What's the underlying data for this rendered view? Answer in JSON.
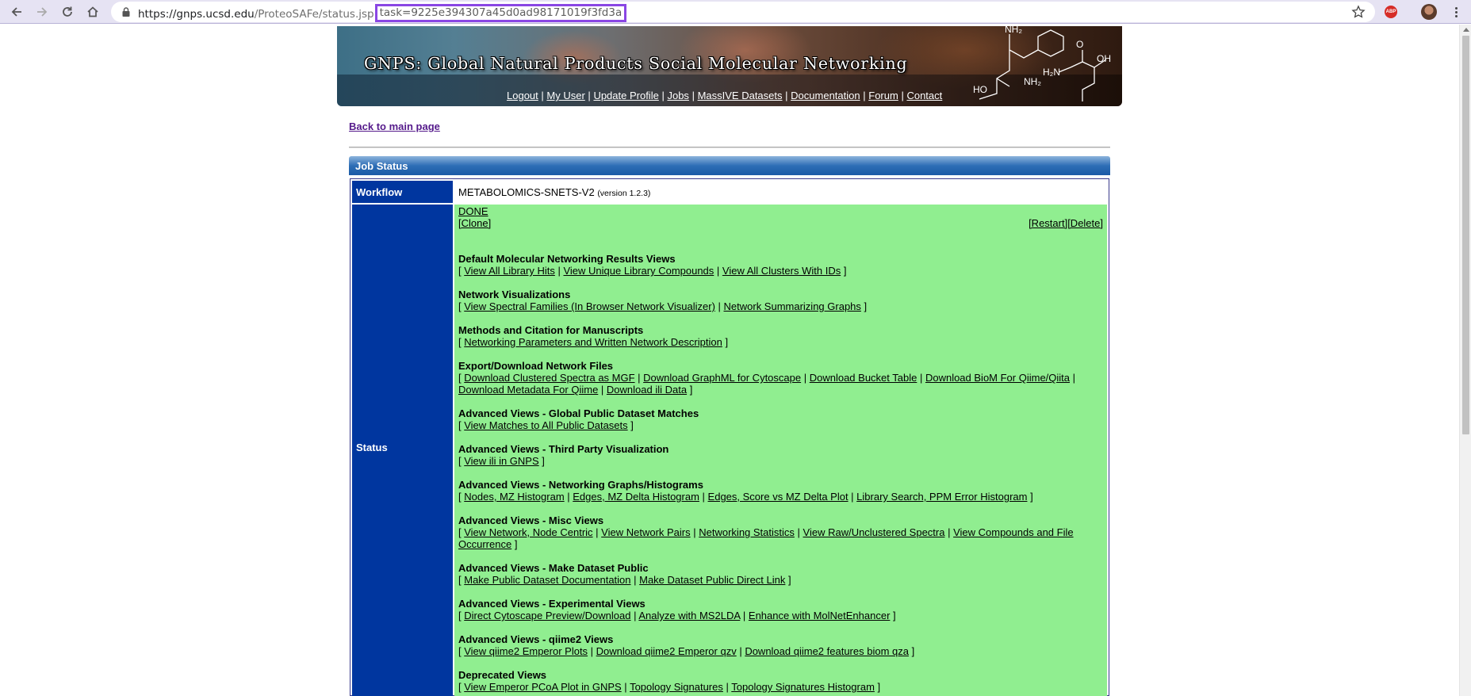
{
  "browser": {
    "url_host": "https://gnps.ucsd.edu",
    "url_path": "/ProteoSAFe/status.jsp",
    "url_query": "task=9225e394307a45d0ad98171019f3fd3a",
    "extension_label": "ABP",
    "icons": [
      "back-icon",
      "forward-icon",
      "reload-icon",
      "home-icon",
      "lock-icon",
      "star-icon",
      "menu-icon"
    ]
  },
  "banner": {
    "title": "GNPS: Global Natural Products Social Molecular Networking",
    "nav": [
      "Logout",
      "My User",
      "Update Profile",
      "Jobs",
      "MassIVE Datasets",
      "Documentation",
      "Forum",
      "Contact"
    ],
    "nav_sep": "|"
  },
  "back_link": "Back to main page",
  "section_title": "Job Status",
  "workflow": {
    "label": "Workflow",
    "name": "METABOLOMICS-SNETS-V2",
    "version": "(version 1.2.3)"
  },
  "status": {
    "label": "Status",
    "state": "DONE",
    "clone": "[Clone]",
    "restart": "[Restart]",
    "delete": "[Delete]",
    "groups": [
      {
        "title": "Default Molecular Networking Results Views",
        "links": [
          "View All Library Hits",
          "View Unique Library Compounds",
          "View All Clusters With IDs"
        ]
      },
      {
        "title": "Network Visualizations",
        "links": [
          "View Spectral Families (In Browser Network Visualizer)",
          "Network Summarizing Graphs"
        ]
      },
      {
        "title": "Methods and Citation for Manuscripts",
        "links": [
          "Networking Parameters and Written Network Description"
        ]
      },
      {
        "title": "Export/Download Network Files",
        "links": [
          "Download Clustered Spectra as MGF",
          "Download GraphML for Cytoscape",
          "Download Bucket Table",
          "Download BioM For Qiime/Qiita",
          "Download Metadata For Qiime",
          "Download ili Data"
        ]
      },
      {
        "title": "Advanced Views - Global Public Dataset Matches",
        "links": [
          "View Matches to All Public Datasets"
        ]
      },
      {
        "title": "Advanced Views - Third Party Visualization",
        "links": [
          "View ili in GNPS"
        ]
      },
      {
        "title": "Advanced Views - Networking Graphs/Histograms",
        "links": [
          "Nodes, MZ Histogram",
          "Edges, MZ Delta Histogram",
          "Edges, Score vs MZ Delta Plot",
          "Library Search, PPM Error Histogram"
        ]
      },
      {
        "title": "Advanced Views - Misc Views",
        "links": [
          "View Network, Node Centric",
          "View Network Pairs",
          "Networking Statistics",
          "View Raw/Unclustered Spectra",
          "View Compounds and File Occurrence"
        ]
      },
      {
        "title": "Advanced Views - Make Dataset Public",
        "links": [
          "Make Public Dataset Documentation",
          "Make Dataset Public Direct Link"
        ]
      },
      {
        "title": "Advanced Views - Experimental Views",
        "links": [
          "Direct Cytoscape Preview/Download",
          "Analyze with MS2LDA",
          "Enhance with MolNetEnhancer"
        ]
      },
      {
        "title": "Advanced Views - qiime2 Views",
        "links": [
          "View qiime2 Emperor Plots",
          "Download qiime2 Emperor qzv",
          "Download qiime2 features biom qza"
        ]
      },
      {
        "title": "Deprecated Views",
        "links": [
          "View Emperor PCoA Plot in GNPS",
          "Topology Signatures",
          "Topology Signatures Histogram"
        ]
      }
    ]
  },
  "colors": {
    "status_bg": "#90ee90",
    "label_bg": "#00369f",
    "url_highlight": "#8a46e4"
  }
}
